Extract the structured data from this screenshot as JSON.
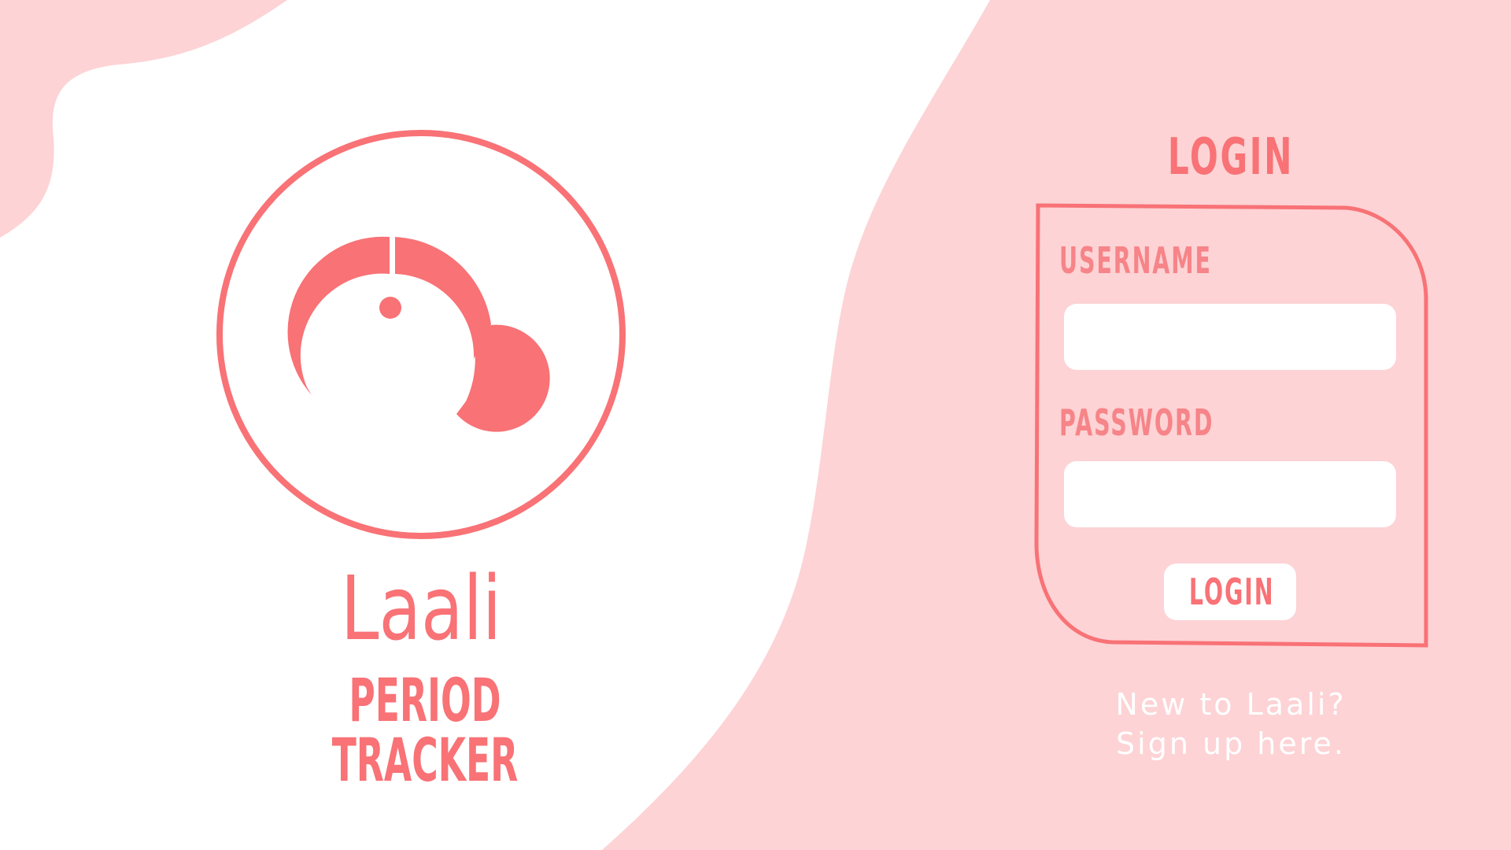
{
  "brand": {
    "name": "Laali",
    "subtitle": "PERIOD TRACKER",
    "logo_icon": "laali-logo-icon"
  },
  "login": {
    "title": "LOGIN",
    "username_label": "USERNAME",
    "username_value": "",
    "password_label": "PASSWORD",
    "password_value": "",
    "button_label": "LOGIN"
  },
  "signup": {
    "line1": "New to Laali?",
    "line2": "Sign up here."
  },
  "colors": {
    "accent": "#f87276",
    "label": "#f68488",
    "panel_background": "#fdd3d5",
    "page_background": "#ffffff",
    "input_background": "#ffffff"
  }
}
